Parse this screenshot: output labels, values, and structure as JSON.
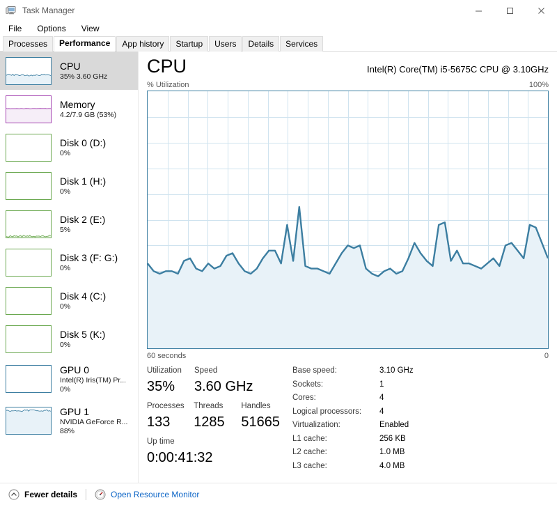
{
  "window": {
    "title": "Task Manager",
    "icon": "task-manager-icon",
    "minimize": "─",
    "maximize": "□",
    "close": "✕"
  },
  "menu": {
    "items": [
      "File",
      "Options",
      "View"
    ]
  },
  "tabs": {
    "items": [
      "Processes",
      "Performance",
      "App history",
      "Startup",
      "Users",
      "Details",
      "Services"
    ],
    "active": "Performance"
  },
  "sidebar": {
    "items": [
      {
        "title": "CPU",
        "sub1": "35%  3.60 GHz",
        "sub2": "",
        "color": "#3c7ea1",
        "selected": true,
        "trace": "flat-noise",
        "level": 0.35
      },
      {
        "title": "Memory",
        "sub1": "4.2/7.9 GB (53%)",
        "sub2": "",
        "color": "#a342b0",
        "selected": false,
        "trace": "flat-line",
        "level": 0.53
      },
      {
        "title": "Disk 0 (D:)",
        "sub1": "0%",
        "sub2": "",
        "color": "#6aa84f",
        "selected": false,
        "trace": "empty",
        "level": 0.0
      },
      {
        "title": "Disk 1 (H:)",
        "sub1": "0%",
        "sub2": "",
        "color": "#6aa84f",
        "selected": false,
        "trace": "empty",
        "level": 0.0
      },
      {
        "title": "Disk 2 (E:)",
        "sub1": "5%",
        "sub2": "",
        "color": "#6aa84f",
        "selected": false,
        "trace": "low-noise",
        "level": 0.05
      },
      {
        "title": "Disk 3 (F: G:)",
        "sub1": "0%",
        "sub2": "",
        "color": "#6aa84f",
        "selected": false,
        "trace": "empty",
        "level": 0.0
      },
      {
        "title": "Disk 4 (C:)",
        "sub1": "0%",
        "sub2": "",
        "color": "#6aa84f",
        "selected": false,
        "trace": "empty",
        "level": 0.0
      },
      {
        "title": "Disk 5 (K:)",
        "sub1": "0%",
        "sub2": "",
        "color": "#6aa84f",
        "selected": false,
        "trace": "empty",
        "level": 0.0
      },
      {
        "title": "GPU 0",
        "sub1": "Intel(R) Iris(TM) Pr...",
        "sub2": "0%",
        "color": "#3c7ea1",
        "selected": false,
        "trace": "empty",
        "level": 0.0
      },
      {
        "title": "GPU 1",
        "sub1": "NVIDIA GeForce R...",
        "sub2": "88%",
        "color": "#3c7ea1",
        "selected": false,
        "trace": "high-noise",
        "level": 0.88
      }
    ]
  },
  "main": {
    "heading": "CPU",
    "model": "Intel(R) Core(TM) i5-5675C CPU @ 3.10GHz",
    "axis_y_label": "% Utilization",
    "axis_y_max": "100%",
    "axis_x_left": "60 seconds",
    "axis_x_right": "0",
    "stats_left": [
      {
        "label": "Utilization",
        "value": "35%"
      },
      {
        "label": "Speed",
        "value": "3.60 GHz"
      },
      {
        "label": "Processes",
        "value": "133"
      },
      {
        "label": "Threads",
        "value": "1285"
      },
      {
        "label": "Handles",
        "value": "51665"
      },
      {
        "label": "Up time",
        "value": "0:00:41:32"
      }
    ],
    "details": [
      {
        "label": "Base speed:",
        "value": "3.10 GHz"
      },
      {
        "label": "Sockets:",
        "value": "1"
      },
      {
        "label": "Cores:",
        "value": "4"
      },
      {
        "label": "Logical processors:",
        "value": "4"
      },
      {
        "label": "Virtualization:",
        "value": "Enabled"
      },
      {
        "label": "L1 cache:",
        "value": "256 KB"
      },
      {
        "label": "L2 cache:",
        "value": "1.0 MB"
      },
      {
        "label": "L3 cache:",
        "value": "4.0 MB"
      }
    ]
  },
  "statusbar": {
    "fewer_details": "Fewer details",
    "resource_monitor": "Open Resource Monitor",
    "chevron_icon": "chevron-up-icon",
    "rm_icon": "resource-monitor-icon"
  },
  "colors": {
    "graph_line": "#3c7ea1",
    "graph_fill": "#e8f2f8",
    "grid": "#cfe3ef",
    "link": "#0b64c6",
    "selected_bg": "#d9d9d9"
  },
  "chart_data": {
    "type": "area",
    "title": "CPU % Utilization",
    "xlabel": "60 seconds",
    "ylabel": "% Utilization",
    "ylim": [
      0,
      100
    ],
    "xlim": [
      60,
      0
    ],
    "grid": true,
    "legend": "none",
    "series": [
      {
        "name": "% Utilization",
        "values": [
          33,
          30,
          29,
          30,
          30,
          29,
          34,
          35,
          31,
          30,
          33,
          31,
          32,
          36,
          37,
          33,
          30,
          29,
          31,
          35,
          38,
          38,
          33,
          48,
          34,
          55,
          32,
          31,
          31,
          30,
          29,
          33,
          37,
          40,
          39,
          40,
          31,
          29,
          28,
          30,
          31,
          29,
          30,
          35,
          41,
          37,
          34,
          32,
          48,
          49,
          34,
          38,
          33,
          33,
          32,
          31,
          33,
          35,
          32,
          40,
          41,
          38,
          35,
          48,
          47,
          41,
          35
        ]
      }
    ]
  }
}
